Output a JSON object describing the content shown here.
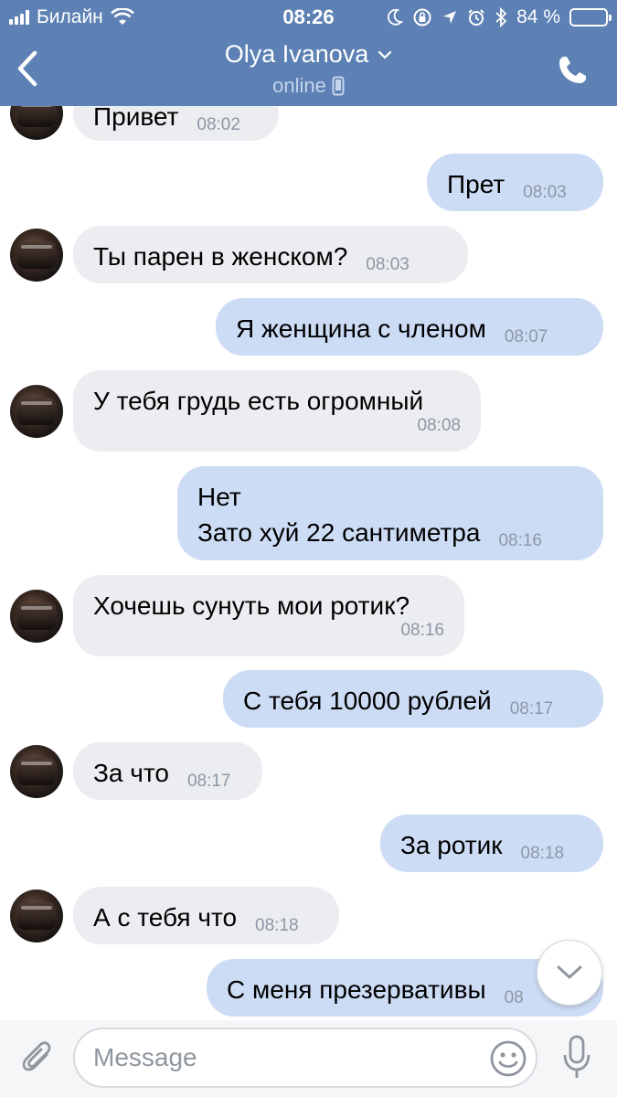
{
  "status_bar": {
    "carrier": "Билайн",
    "time": "08:26",
    "battery_text": "84 %",
    "battery_level": 0.84
  },
  "header": {
    "contact_name": "Olya Ivanova",
    "status": "online",
    "back_icon": "chevron-left-icon",
    "call_icon": "phone-icon"
  },
  "messages": [
    {
      "dir": "in",
      "text": "Привет",
      "time": "08:02"
    },
    {
      "dir": "out",
      "text": "Прет",
      "time": "08:03"
    },
    {
      "dir": "in",
      "text": "Ты парен в женском?",
      "time": "08:03"
    },
    {
      "dir": "out",
      "text": "Я женщина с членом",
      "time": "08:07"
    },
    {
      "dir": "in",
      "text": "У тебя грудь есть огромный",
      "time": "08:08"
    },
    {
      "dir": "out",
      "text": "Нет\nЗато хуй 22 сантиметра",
      "time": "08:16"
    },
    {
      "dir": "in",
      "text": "Хочешь сунуть мои ротик?",
      "time": "08:16"
    },
    {
      "dir": "out",
      "text": "С тебя 10000 рублей",
      "time": "08:17"
    },
    {
      "dir": "in",
      "text": "За что",
      "time": "08:17"
    },
    {
      "dir": "out",
      "text": "За ротик",
      "time": "08:18"
    },
    {
      "dir": "in",
      "text": "А с тебя что",
      "time": "08:18"
    },
    {
      "dir": "out",
      "text": "С меня презервативы",
      "time": "08"
    }
  ],
  "composer": {
    "placeholder": "Message",
    "value": ""
  },
  "colors": {
    "header": "#5d81b4",
    "incoming_bubble": "#ebedf0",
    "outgoing_bubble": "#cddcf5",
    "time_text": "#8d97a5",
    "icon_gray": "#8f969e"
  }
}
